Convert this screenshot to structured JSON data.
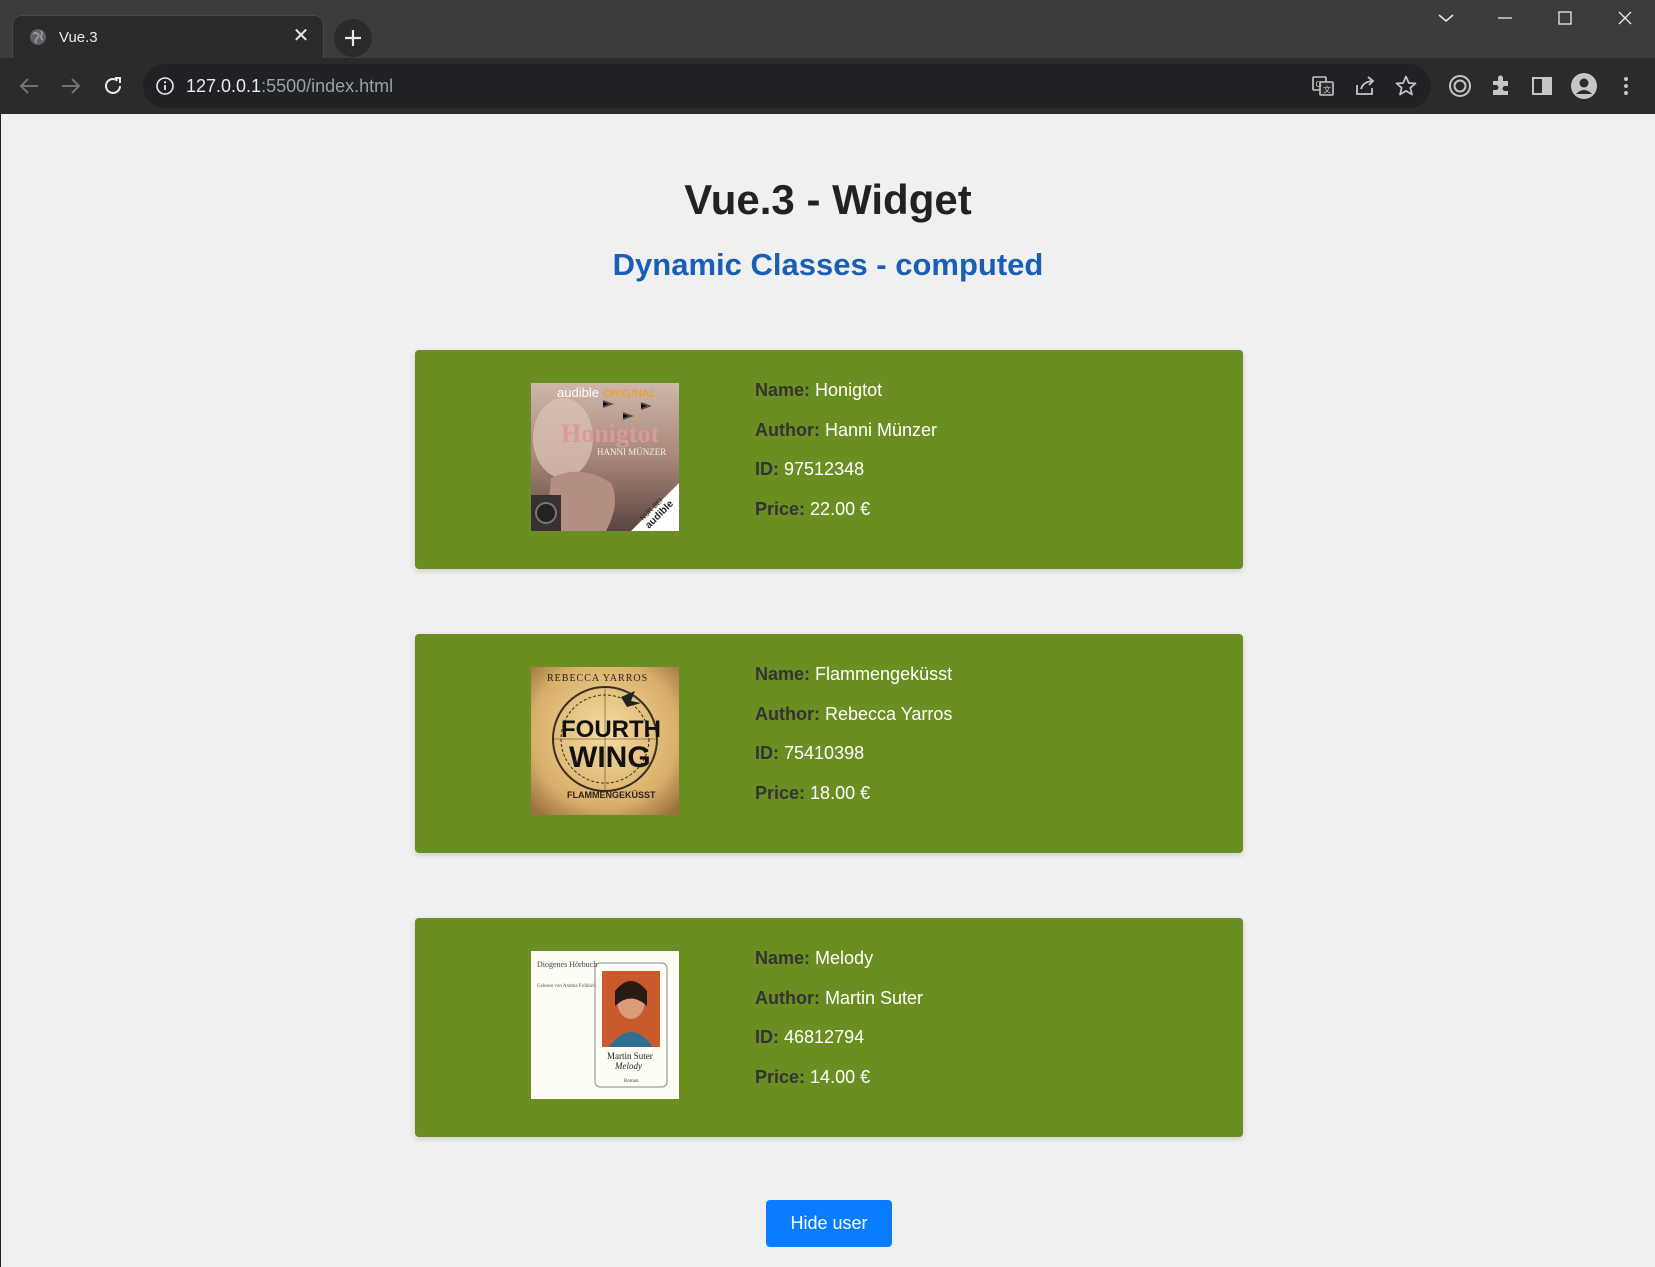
{
  "browser": {
    "tab_title": "Vue.3",
    "url_host": "127.0.0.1",
    "url_rest": ":5500/index.html"
  },
  "page": {
    "title": "Vue.3 - Widget",
    "subtitle": "Dynamic Classes - computed",
    "card_color": "#6b8e23",
    "labels": {
      "name": "Name:",
      "author": "Author:",
      "id": "ID:",
      "price": "Price:"
    }
  },
  "books": [
    {
      "name": "Honigtot",
      "author": "Hanni Münzer",
      "id": "97512348",
      "price": "22.00 €",
      "cover": {
        "brand": "audible",
        "brand_suffix": "ORIGINAL",
        "title": "Honigtot",
        "author": "HANNI MÜNZER",
        "badge_top": "NUR BEI",
        "badge_bottom": "audible"
      }
    },
    {
      "name": "Flammengeküsst",
      "author": "Rebecca Yarros",
      "id": "75410398",
      "price": "18.00 €",
      "cover": {
        "author": "REBECCA YARROS",
        "title_top": "FOURTH",
        "title_bottom": "WING",
        "subtitle": "FLAMMENGEKÜSST"
      }
    },
    {
      "name": "Melody",
      "author": "Martin Suter",
      "id": "46812794",
      "price": "14.00 €",
      "cover": {
        "publisher": "Diogenes Hörbuch",
        "reader": "Gelesen von Andrea Fröhlich",
        "author": "Martin Suter",
        "title": "Melody",
        "genre": "Roman"
      }
    }
  ],
  "button": {
    "label": "Hide user",
    "color": "#0a7cff"
  }
}
